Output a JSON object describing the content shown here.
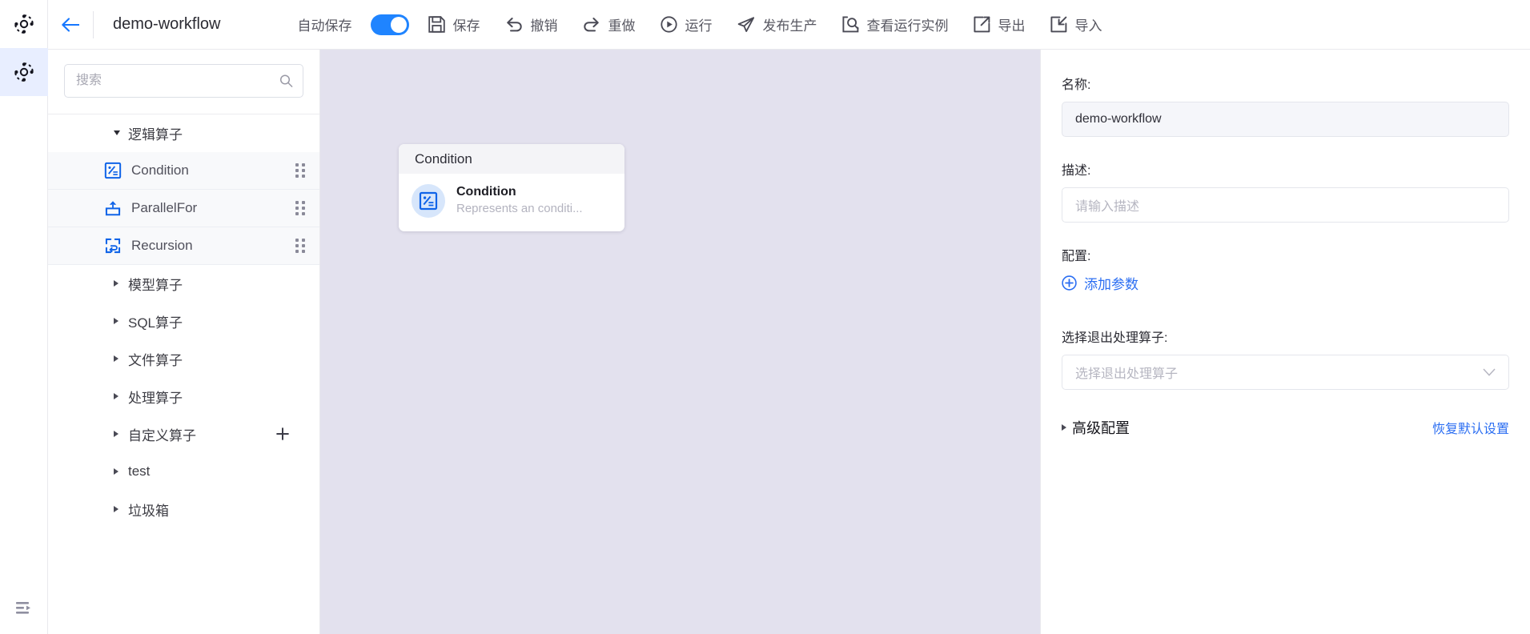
{
  "app": {
    "accent": "#2b6ef2",
    "switch_on_color": "#1f84ff",
    "canvas_bg": "#e3e1ee"
  },
  "rail": {
    "items": [
      {
        "name": "logo-icon",
        "label": ""
      },
      {
        "name": "settings-icon",
        "label": ""
      }
    ],
    "bottom": {
      "name": "collapse-panel-icon",
      "label": ""
    }
  },
  "topbar": {
    "back_label": "",
    "title": "demo-workflow",
    "autosave_label": "自动保存",
    "autosave_on": true,
    "actions": [
      {
        "id": "save",
        "label": "保存",
        "icon": "save-icon"
      },
      {
        "id": "undo",
        "label": "撤销",
        "icon": "undo-icon"
      },
      {
        "id": "redo",
        "label": "重做",
        "icon": "redo-icon"
      },
      {
        "id": "run",
        "label": "运行",
        "icon": "play-circle-icon"
      },
      {
        "id": "publish",
        "label": "发布生产",
        "icon": "send-icon"
      },
      {
        "id": "view-instances",
        "label": "查看运行实例",
        "icon": "inspect-icon"
      },
      {
        "id": "export",
        "label": "导出",
        "icon": "export-icon"
      },
      {
        "id": "import",
        "label": "导入",
        "icon": "import-icon"
      }
    ]
  },
  "sidebar": {
    "search": {
      "value": "",
      "placeholder": "搜索"
    },
    "tree": [
      {
        "id": "logic",
        "label": "逻辑算子",
        "expanded": true,
        "has_add": false,
        "operators": [
          {
            "id": "condition",
            "label": "Condition",
            "icon": "condition-icon"
          },
          {
            "id": "parallelfor",
            "label": "ParallelFor",
            "icon": "parallelfor-icon"
          },
          {
            "id": "recursion",
            "label": "Recursion",
            "icon": "recursion-icon"
          }
        ]
      },
      {
        "id": "model",
        "label": "模型算子",
        "expanded": false,
        "has_add": false,
        "operators": []
      },
      {
        "id": "sql",
        "label": "SQL算子",
        "expanded": false,
        "has_add": false,
        "operators": []
      },
      {
        "id": "file",
        "label": "文件算子",
        "expanded": false,
        "has_add": false,
        "operators": []
      },
      {
        "id": "process",
        "label": "处理算子",
        "expanded": false,
        "has_add": false,
        "operators": []
      },
      {
        "id": "custom",
        "label": "自定义算子",
        "expanded": false,
        "has_add": true,
        "operators": []
      },
      {
        "id": "test",
        "label": "test",
        "expanded": false,
        "has_add": false,
        "operators": []
      },
      {
        "id": "trash",
        "label": "垃圾箱",
        "expanded": false,
        "has_add": false,
        "operators": []
      }
    ]
  },
  "canvas": {
    "header_title": "demo-workflow",
    "node": {
      "header": "Condition",
      "title": "Condition",
      "description": "Represents an conditi...",
      "icon": "condition-icon"
    }
  },
  "rightpanel": {
    "title": "demo-workflow",
    "toggle_icon": "collapse-panel-icon",
    "name_label": "名称:",
    "name_value": "demo-workflow",
    "desc_label": "描述:",
    "desc_value": "",
    "desc_placeholder": "请输入描述",
    "config_label": "配置:",
    "add_param_label": "添加参数",
    "exit_op_label": "选择退出处理算子:",
    "exit_op_value": "",
    "exit_op_placeholder": "选择退出处理算子",
    "advanced_label": "高级配置",
    "reset_label": "恢复默认设置"
  }
}
